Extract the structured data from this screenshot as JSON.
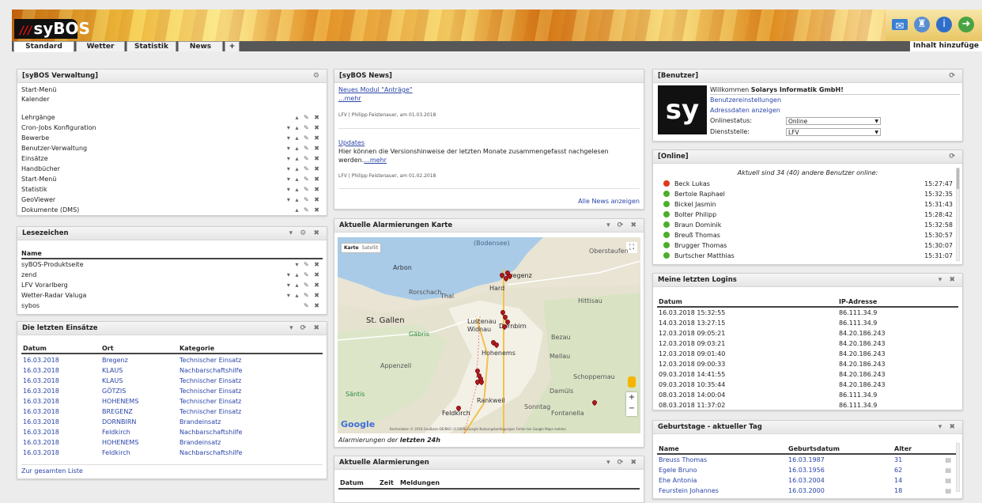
{
  "app": {
    "logo_text": "syBOS",
    "add_content": "Inhalt hinzufüge"
  },
  "icons": {
    "mail": "mail-icon",
    "users": "users-icon",
    "info": "info-icon",
    "logout": "logout-icon"
  },
  "tabs": [
    {
      "label": "Standard"
    },
    {
      "label": "Wetter"
    },
    {
      "label": "Statistik"
    },
    {
      "label": "News"
    },
    {
      "label": "+"
    }
  ],
  "verwaltung": {
    "title": "[syBOS Verwaltung]",
    "top": [
      "Start-Menü",
      "Kalender"
    ],
    "items": [
      "Lehrgänge",
      "Cron-Jobs Konfiguration",
      "Bewerbe",
      "Benutzer-Verwaltung",
      "Einsätze",
      "Handbücher",
      "Start-Menü",
      "Statistik",
      "GeoViewer",
      "Dokumente (DMS)"
    ]
  },
  "lesezeichen": {
    "title": "Lesezeichen",
    "header": "Name",
    "items": [
      "syBOS-Produktseite",
      "zend",
      "LFV Vorarlberg",
      "Wetter-Radar Valuga",
      "sybos"
    ]
  },
  "einsaetze": {
    "title": "Die letzten Einsätze",
    "headers": [
      "Datum",
      "Ort",
      "Kategorie"
    ],
    "rows": [
      [
        "16.03.2018",
        "Bregenz",
        "Technischer Einsatz"
      ],
      [
        "16.03.2018",
        "KLAUS",
        "Nachbarschaftshilfe"
      ],
      [
        "16.03.2018",
        "KLAUS",
        "Technischer Einsatz"
      ],
      [
        "16.03.2018",
        "GÖTZIS",
        "Technischer Einsatz"
      ],
      [
        "16.03.2018",
        "HOHENEMS",
        "Technischer Einsatz"
      ],
      [
        "16.03.2018",
        "BREGENZ",
        "Technischer Einsatz"
      ],
      [
        "16.03.2018",
        "DORNBIRN",
        "Brandeinsatz"
      ],
      [
        "16.03.2018",
        "Feldkirch",
        "Nachbarschaftshilfe"
      ],
      [
        "16.03.2018",
        "HOHENEMS",
        "Brandeinsatz"
      ],
      [
        "16.03.2018",
        "Feldkirch",
        "Nachbarschaftshilfe"
      ]
    ],
    "footer": "Zur gesamten Liste"
  },
  "news": {
    "title": "[syBOS News]",
    "items": [
      {
        "title": "Neues Modul \"Anträge\"",
        "body": "",
        "more": "...mehr",
        "meta": "LFV | Philipp Feistenauer, am 01.03.2018"
      },
      {
        "title": "Updates",
        "body": "Hier können die Versionshinweise der letzten Monate zusammengefasst nachgelesen werden.",
        "more": "...mehr",
        "meta": "LFV | Philipp Feistenauer, am 01.02.2018"
      }
    ],
    "all_link": "Alle News anzeigen"
  },
  "karte": {
    "title": "Aktuelle Alarmierungen Karte",
    "map_btn_karte": "Karte",
    "map_btn_satellit": "Satellit",
    "labels": {
      "bodensee": "(Bodensee)",
      "stgallen": "St. Gallen",
      "bregenz": "Bregenz",
      "hard": "Hard",
      "rorschach": "Rorschach",
      "thal": "Thal",
      "hittisau": "Hittisau",
      "lustenau": "Lustenau",
      "widnau": "Widnau",
      "dornbirn": "Dornbirn",
      "bezau": "Bezau",
      "appenzell": "Appenzell",
      "mellau": "Mellau",
      "gaebris": "Gäbris",
      "hohenems": "Hohenems",
      "rankweil": "Rankweil",
      "feldkirch": "Feldkirch",
      "damuels": "Damüls",
      "sontag": "Sonntag",
      "schoppernau": "Schoppernau",
      "saentis": "Säntis",
      "fontanella": "Fontanella",
      "arbon": "Arbon",
      "oberstaufen": "Oberstaufen",
      "google": "Google",
      "attribution": "Kartendaten © 2018 GeoBasis-DE/BKG (©2009),Google   Nutzungsbedingungen   Fehler bei Google Maps melden"
    },
    "caption_prefix": "Alarmierungen der ",
    "caption_bold": "letzten 24h"
  },
  "alarmierungen": {
    "title": "Aktuelle Alarmierungen",
    "headers": [
      "Datum",
      "Zeit",
      "Meldungen"
    ]
  },
  "benutzer": {
    "title": "[Benutzer]",
    "welcome_prefix": "Willkommen ",
    "welcome_name": "Solarys Informatik GmbH!",
    "link1": "Benutzereinstellungen",
    "link2": "Adressdaten anzeigen",
    "status_label": "Onlinestatus:",
    "status_value": "Online",
    "dienst_label": "Dienststelle:",
    "dienst_value": "LFV",
    "avatar_text": "sy"
  },
  "online": {
    "title": "[Online]",
    "summary": "Aktuell sind 34 (40) andere Benutzer online:",
    "users": [
      {
        "name": "Beck Lukas",
        "time": "15:27:47",
        "status": "busy"
      },
      {
        "name": "Bertole Raphael",
        "time": "15:32:35",
        "status": "online"
      },
      {
        "name": "Bickel Jasmin",
        "time": "15:31:43",
        "status": "online"
      },
      {
        "name": "Bolter Philipp",
        "time": "15:28:42",
        "status": "online"
      },
      {
        "name": "Braun Dominik",
        "time": "15:32:58",
        "status": "online"
      },
      {
        "name": "Breuß Thomas",
        "time": "15:30:57",
        "status": "online"
      },
      {
        "name": "Brugger Thomas",
        "time": "15:30:07",
        "status": "online"
      },
      {
        "name": "Burtscher Matthias",
        "time": "15:31:07",
        "status": "online"
      }
    ],
    "colors": {
      "online": "#4caf2a",
      "busy": "#e03a1c"
    }
  },
  "logins": {
    "title": "Meine letzten Logins",
    "headers": [
      "Datum",
      "IP-Adresse"
    ],
    "rows": [
      [
        "16.03.2018 15:32:55",
        "86.111.34.9"
      ],
      [
        "14.03.2018 13:27:15",
        "86.111.34.9"
      ],
      [
        "12.03.2018 09:05:21",
        "84.20.186.243"
      ],
      [
        "12.03.2018 09:03:21",
        "84.20.186.243"
      ],
      [
        "12.03.2018 09:01:40",
        "84.20.186.243"
      ],
      [
        "12.03.2018 09:00:33",
        "84.20.186.243"
      ],
      [
        "09.03.2018 14:41:55",
        "84.20.186.243"
      ],
      [
        "09.03.2018 10:35:44",
        "84.20.186.243"
      ],
      [
        "08.03.2018 14:00:04",
        "86.111.34.9"
      ],
      [
        "08.03.2018 11:37:02",
        "86.111.34.9"
      ]
    ]
  },
  "geburtstage": {
    "title": "Geburtstage - aktueller Tag",
    "headers": [
      "Name",
      "Geburtsdatum",
      "Alter"
    ],
    "rows": [
      [
        "Breuss Thomas",
        "16.03.1987",
        "31"
      ],
      [
        "Egele Bruno",
        "16.03.1956",
        "62"
      ],
      [
        "Ehe Antonia",
        "16.03.2004",
        "14"
      ],
      [
        "Feurstein Johannes",
        "16.03.2000",
        "18"
      ]
    ]
  }
}
